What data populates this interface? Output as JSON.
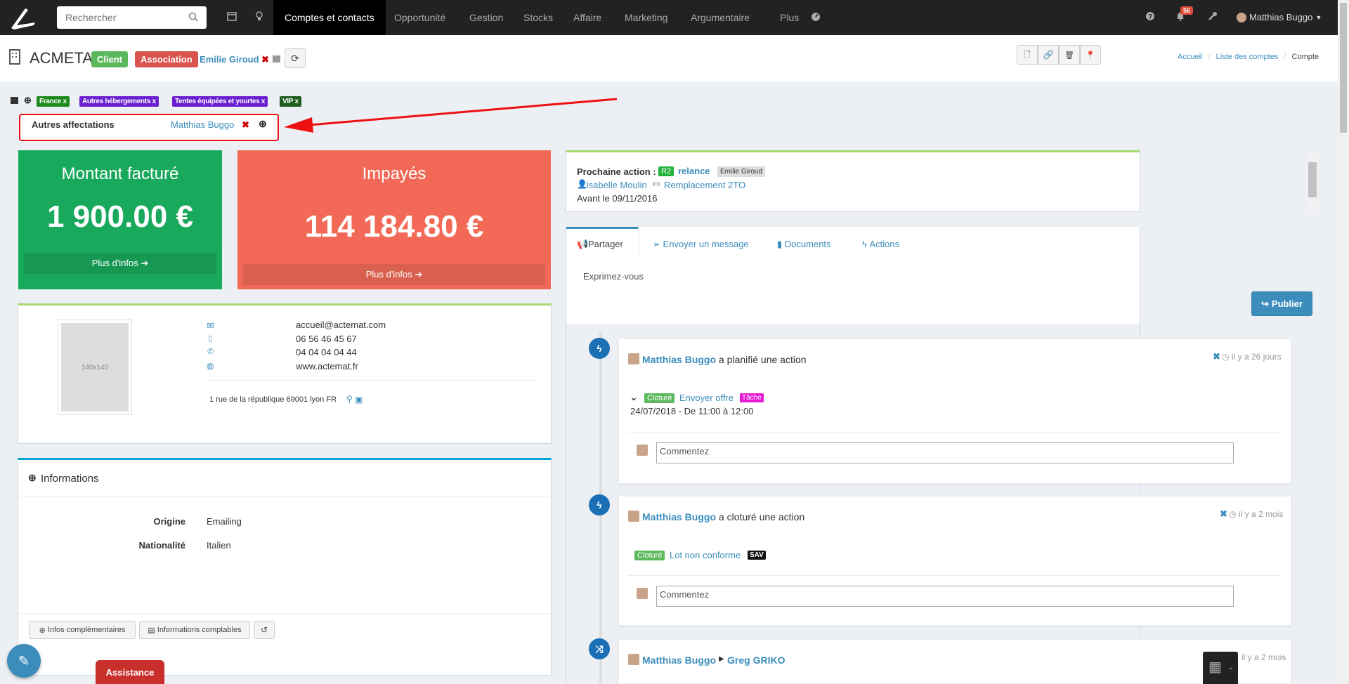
{
  "nav": {
    "search_placeholder": "Rechercher",
    "items": [
      "Comptes et contacts",
      "Opportunité",
      "Gestion",
      "Stocks",
      "Affaire",
      "Marketing",
      "Argumentaire",
      "Plus"
    ],
    "notif_count": "56",
    "user": "Matthias Buggo"
  },
  "header": {
    "title": "ACMETA",
    "label_client": "Client",
    "label_association": "Association",
    "owner": "Emilie Giroud",
    "breadcrumb": [
      "Accueil",
      "Liste des comptes",
      "Compte"
    ]
  },
  "tags": [
    "France x",
    "Autres hébergements x",
    "Tentes équipées et yourtes x",
    "VIP x"
  ],
  "affectations": {
    "label": "Autres affectations",
    "user": "Matthias Buggo"
  },
  "kpi": {
    "billed_title": "Montant facturé",
    "billed_value": "1 900.00 €",
    "billed_more": "Plus d'infos",
    "unpaid_title": "Impayés",
    "unpaid_value": "114 184.80 €",
    "unpaid_more": "Plus d'infos"
  },
  "contact": {
    "placeholder": "140x140",
    "email": "accueil@actemat.com",
    "mobile": "06 56 46 45 67",
    "phone": "04 04 04 04 44",
    "website": "www.actemat.fr",
    "address": "1 rue de la république 69001 lyon FR"
  },
  "informations": {
    "title": "Informations",
    "rows": [
      {
        "label": "Origine",
        "value": "Emailing"
      },
      {
        "label": "Nationalité",
        "value": "Italien"
      }
    ],
    "btn_more": "Infos complémentaires",
    "btn_accounting": "Informations comptables"
  },
  "next_action": {
    "label": "Prochaine action :",
    "code": "R2",
    "name": "relance",
    "owner": "Emilie Giroud",
    "contact": "Isabelle Moulin",
    "opportunity": "Remplacement 2TO",
    "deadline": "Avant le 09/11/2016"
  },
  "tabs": [
    "Partager",
    "Envoyer un message",
    "Documents",
    "Actions"
  ],
  "share": {
    "placeholder": "Exprimez-vous",
    "publish": "Publier"
  },
  "timeline": [
    {
      "user": "Matthias Buggo",
      "action": "a planifié une action",
      "time": "il y a 26 jours",
      "status": "Cloturé",
      "subject": "Envoyer offre",
      "type": "Tâche",
      "date": "24/07/2018 - De 11:00 à 12:00",
      "comment": "Commentez"
    },
    {
      "user": "Matthias Buggo",
      "action": "a cloturé une action",
      "time": "il y a 2 mois",
      "status": "Cloturé",
      "subject": "Lot non conforme",
      "type": "SAV",
      "comment": "Commentez"
    },
    {
      "user": "Matthias Buggo",
      "target": "Greg GRIKO",
      "time": "il y a 2 mois"
    }
  ],
  "assistance": "Assistance"
}
